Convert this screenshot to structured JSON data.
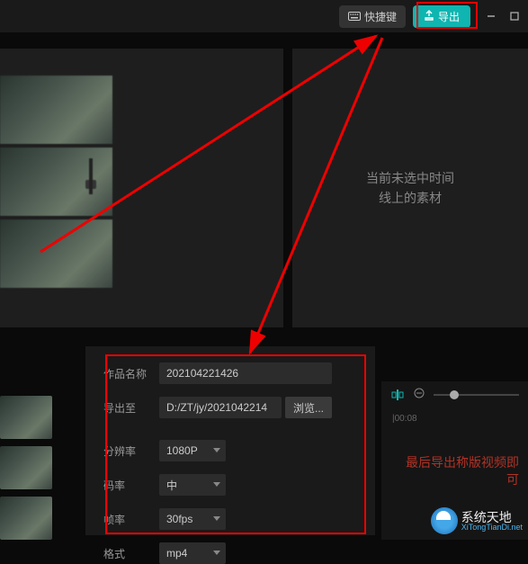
{
  "topbar": {
    "shortcut_label": "快捷键",
    "export_label": "导出"
  },
  "preview": {
    "empty_line1": "当前未选中时间",
    "empty_line2": "线上的素材"
  },
  "export_dialog": {
    "name_label": "作品名称",
    "name_value": "202104221426",
    "path_label": "导出至",
    "path_value": "D:/ZT/jy/2021042214",
    "browse_label": "浏览...",
    "resolution_label": "分辨率",
    "resolution_value": "1080P",
    "bitrate_label": "码率",
    "bitrate_value": "中",
    "fps_label": "帧率",
    "fps_value": "30fps",
    "format_label": "格式",
    "format_value": "mp4"
  },
  "timeline": {
    "ruler_tick": "|00:08"
  },
  "watermark": {
    "red_line1": "最后导出称版视频即",
    "red_line2": "可",
    "site_name": "系统天地",
    "site_url": "XiTongTianDi.net"
  }
}
